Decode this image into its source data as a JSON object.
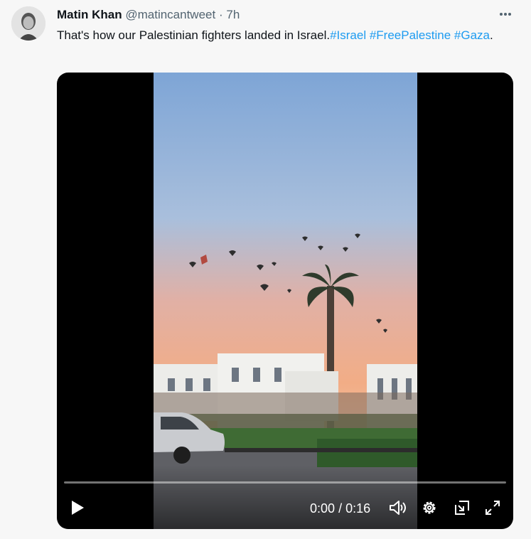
{
  "tweet": {
    "author_name": "Matin Khan",
    "handle": "@matincantweet",
    "separator": "·",
    "time": "7h",
    "text_plain": "That's how our Palestinian fighters landed in Israel.",
    "hashtags": [
      "#Israel",
      "#FreePalestine",
      "#Gaza"
    ],
    "text_end": "."
  },
  "video": {
    "current_time": "0:00",
    "time_separator": "/",
    "duration": "0:16",
    "progress_fraction": 0
  },
  "icons": {
    "more": "more-icon",
    "play": "play-icon",
    "volume": "volume-icon",
    "settings": "settings-icon",
    "pip": "pip-icon",
    "fullscreen": "fullscreen-icon"
  },
  "colors": {
    "background": "#f7f7f7",
    "text": "#0f1419",
    "secondary_text": "#536471",
    "link": "#1d9bf0"
  }
}
